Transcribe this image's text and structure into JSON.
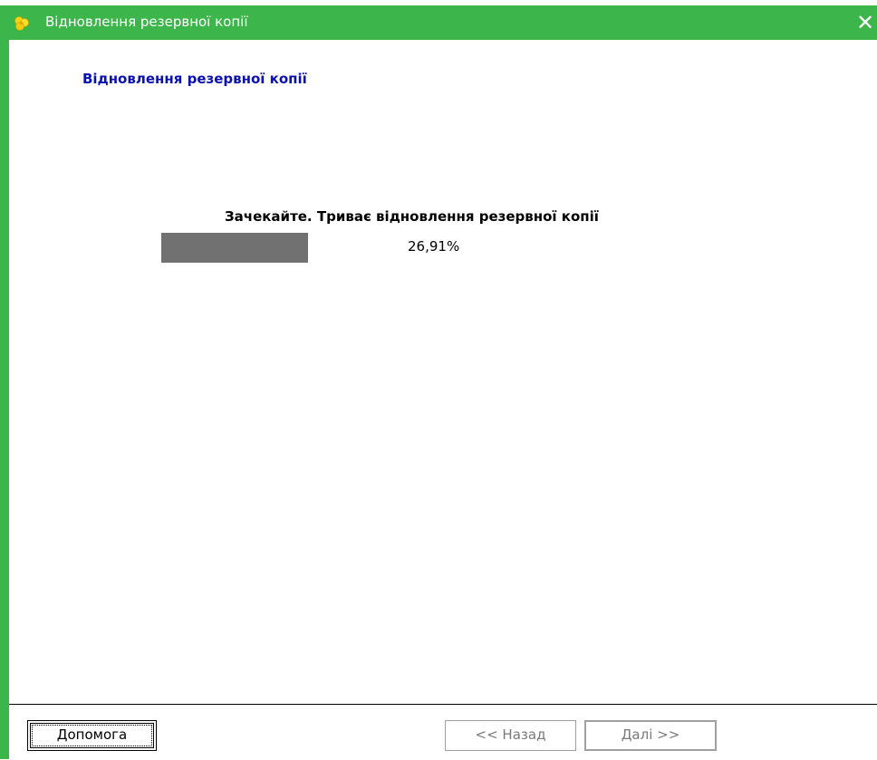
{
  "window": {
    "title": "Відновлення резервної копії",
    "title_bar_color": "#3cb54a",
    "app_icon": "yellow-flower-icon",
    "close_icon": "close-icon",
    "close_label": "✕"
  },
  "page": {
    "title": "Відновлення резервної копії",
    "title_color": "#0b10b0"
  },
  "progress": {
    "status_text": "Зачекайте. Триває відновлення резервної копії",
    "value_percent": 26.91,
    "label": "26,91%",
    "fill_color": "#717171"
  },
  "footer": {
    "help_label": "Допомога",
    "back_label": "<< Назад",
    "next_label": "Далі >>"
  }
}
